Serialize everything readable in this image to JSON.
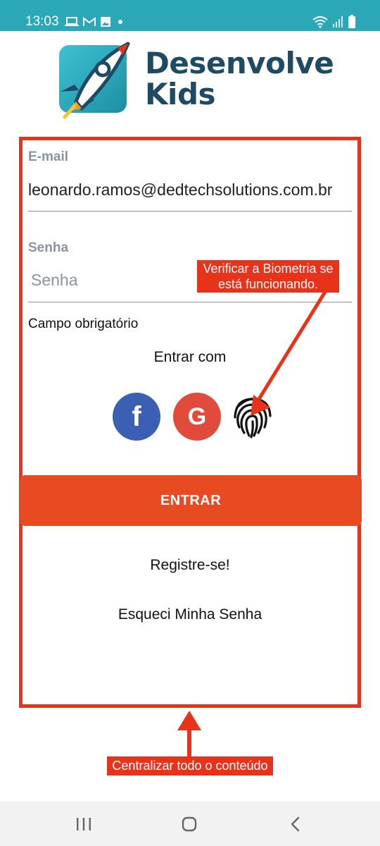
{
  "status_bar": {
    "time": "13:03",
    "left_icons": [
      "laptop-icon",
      "gmail-icon",
      "gallery-icon",
      "dot-icon"
    ],
    "right_icons": [
      "wifi-icon",
      "signal-icon",
      "battery-icon"
    ]
  },
  "brand": {
    "line1": "Desenvolve",
    "line2": "Kids",
    "icon": "rocket-icon"
  },
  "form": {
    "email_label": "E-mail",
    "email_value": "leonardo.ramos@dedtechsolutions.com.br",
    "password_label": "Senha",
    "password_placeholder": "Senha",
    "required_text": "Campo obrigatório",
    "enter_with": "Entrar com"
  },
  "social": {
    "facebook_glyph": "f",
    "google_glyph": "G",
    "biometric_icon": "fingerprint-icon"
  },
  "actions": {
    "enter_label": "ENTRAR",
    "register_label": "Registre-se!",
    "forgot_label": "Esqueci Minha Senha"
  },
  "annotations": {
    "biometric_note_line1": "Verificar a Biometria se",
    "biometric_note_line2": "está funcionando.",
    "center_note": "Centralizar todo o conteúdo"
  },
  "colors": {
    "status_bar": "#2aa8b8",
    "brand_text": "#1e4a64",
    "accent_button": "#e84b22",
    "annotation_red": "#e8321a",
    "facebook": "#3b5fb3",
    "google": "#e14b3b"
  },
  "navbar": {
    "icons": [
      "recent-apps-icon",
      "home-icon",
      "back-icon"
    ]
  }
}
